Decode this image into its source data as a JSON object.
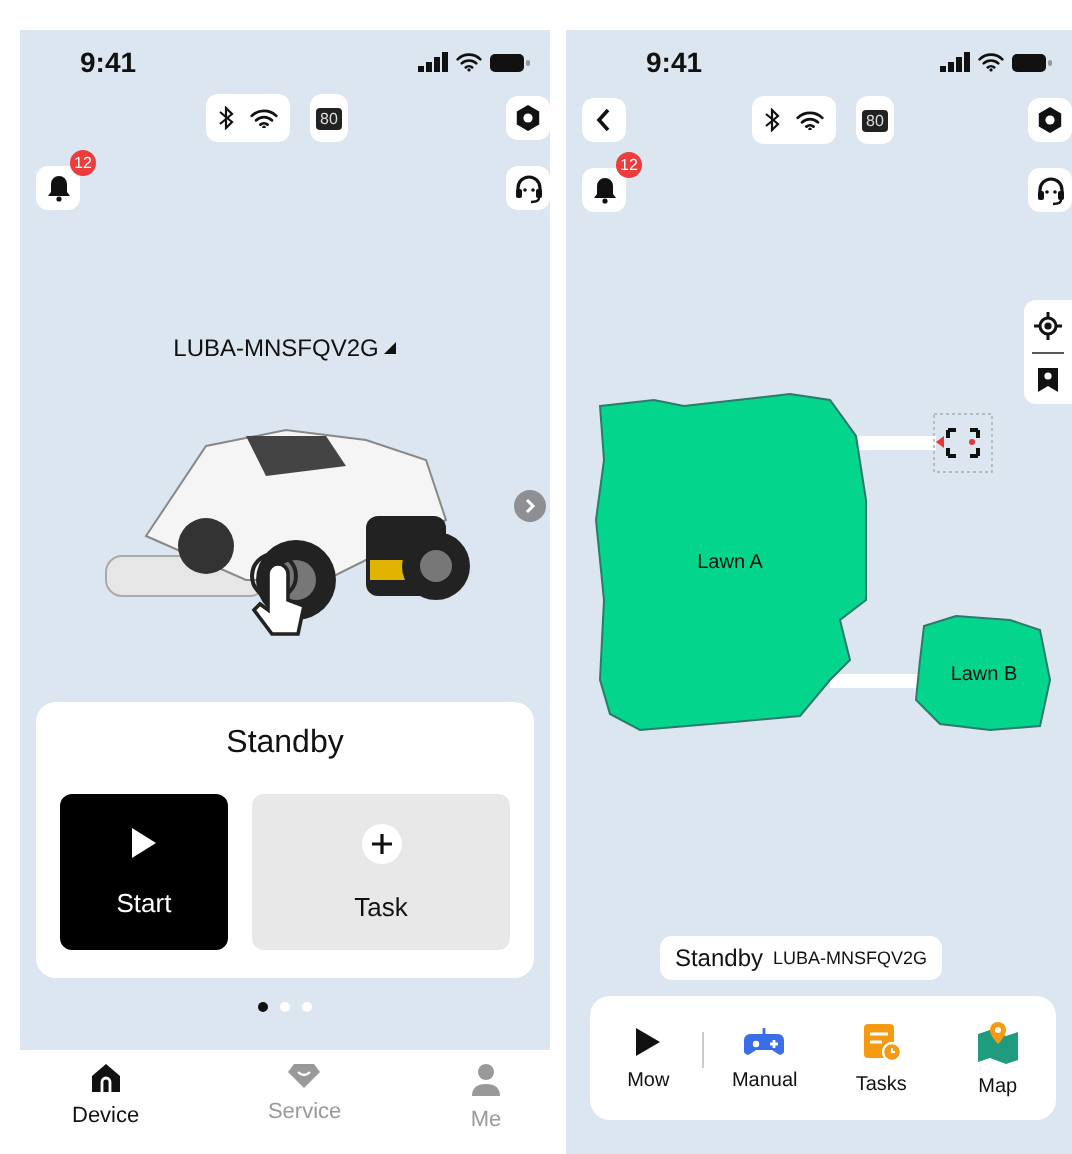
{
  "device_screen": {
    "status_bar": {
      "time": "9:41"
    },
    "battery_text": "80",
    "notification_count": "12",
    "device_name": "LUBA-MNSFQV2G",
    "status": "Standby",
    "actions": [
      {
        "label": "Start",
        "kind": "primary"
      },
      {
        "label": "Task",
        "kind": "secondary"
      }
    ],
    "page_dots": [
      {
        "selected": true
      },
      {
        "selected": false
      },
      {
        "selected": false
      }
    ],
    "tabs": [
      {
        "label": "Device",
        "selected": true,
        "kind": "home"
      },
      {
        "label": "Service",
        "selected": false,
        "kind": "service"
      },
      {
        "label": "Me",
        "selected": false,
        "kind": "person"
      }
    ]
  },
  "map_screen": {
    "status_bar": {
      "time": "9:41"
    },
    "battery_text": "80",
    "notification_count": "12",
    "lawns": [
      {
        "name": "Lawn A"
      },
      {
        "name": "Lawn B"
      }
    ],
    "status": "Standby",
    "device_name": "LUBA-MNSFQV2G",
    "controls": [
      {
        "label": "Mow",
        "kind": "play"
      },
      {
        "label": "Manual",
        "kind": "gamepad"
      },
      {
        "label": "Tasks",
        "kind": "tasks"
      },
      {
        "label": "Map",
        "kind": "map"
      }
    ]
  }
}
